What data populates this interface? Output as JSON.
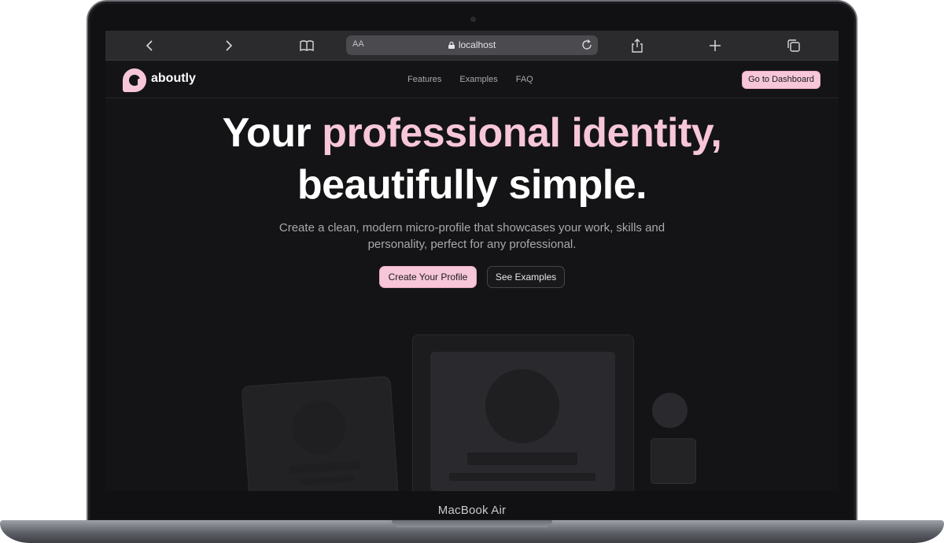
{
  "device": {
    "label": "MacBook Air"
  },
  "browser": {
    "address_prefix": "AA",
    "url": "localhost"
  },
  "site": {
    "logo_text": "aboutly",
    "nav": [
      "Features",
      "Examples",
      "FAQ"
    ],
    "dashboard_button": "Go to Dashboard"
  },
  "hero": {
    "line1_white": "Your ",
    "line1_accent": "professional identity,",
    "line2": "beautifully simple.",
    "subtitle_line1": "Create a clean, modern micro-profile that showcases your work, skills and",
    "subtitle_line2": "personality, perfect for any professional.",
    "primary_cta": "Create Your Profile",
    "secondary_cta": "See Examples"
  },
  "colors": {
    "accent": "#f7c6d9",
    "background": "#141416"
  }
}
